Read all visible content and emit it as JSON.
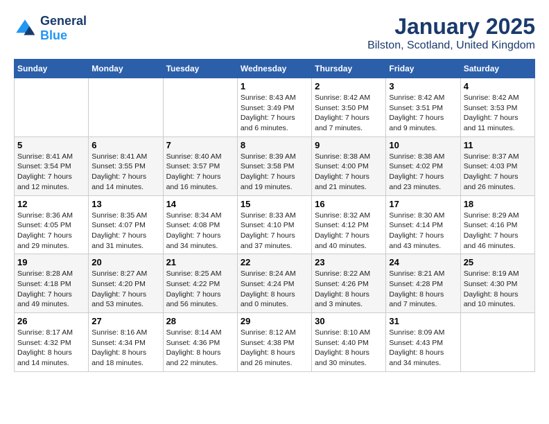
{
  "logo": {
    "general": "General",
    "blue": "Blue"
  },
  "title": "January 2025",
  "location": "Bilston, Scotland, United Kingdom",
  "days_of_week": [
    "Sunday",
    "Monday",
    "Tuesday",
    "Wednesday",
    "Thursday",
    "Friday",
    "Saturday"
  ],
  "weeks": [
    [
      {
        "day": "",
        "sunrise": "",
        "sunset": "",
        "daylight": ""
      },
      {
        "day": "",
        "sunrise": "",
        "sunset": "",
        "daylight": ""
      },
      {
        "day": "",
        "sunrise": "",
        "sunset": "",
        "daylight": ""
      },
      {
        "day": "1",
        "sunrise": "Sunrise: 8:43 AM",
        "sunset": "Sunset: 3:49 PM",
        "daylight": "Daylight: 7 hours and 6 minutes."
      },
      {
        "day": "2",
        "sunrise": "Sunrise: 8:42 AM",
        "sunset": "Sunset: 3:50 PM",
        "daylight": "Daylight: 7 hours and 7 minutes."
      },
      {
        "day": "3",
        "sunrise": "Sunrise: 8:42 AM",
        "sunset": "Sunset: 3:51 PM",
        "daylight": "Daylight: 7 hours and 9 minutes."
      },
      {
        "day": "4",
        "sunrise": "Sunrise: 8:42 AM",
        "sunset": "Sunset: 3:53 PM",
        "daylight": "Daylight: 7 hours and 11 minutes."
      }
    ],
    [
      {
        "day": "5",
        "sunrise": "Sunrise: 8:41 AM",
        "sunset": "Sunset: 3:54 PM",
        "daylight": "Daylight: 7 hours and 12 minutes."
      },
      {
        "day": "6",
        "sunrise": "Sunrise: 8:41 AM",
        "sunset": "Sunset: 3:55 PM",
        "daylight": "Daylight: 7 hours and 14 minutes."
      },
      {
        "day": "7",
        "sunrise": "Sunrise: 8:40 AM",
        "sunset": "Sunset: 3:57 PM",
        "daylight": "Daylight: 7 hours and 16 minutes."
      },
      {
        "day": "8",
        "sunrise": "Sunrise: 8:39 AM",
        "sunset": "Sunset: 3:58 PM",
        "daylight": "Daylight: 7 hours and 19 minutes."
      },
      {
        "day": "9",
        "sunrise": "Sunrise: 8:38 AM",
        "sunset": "Sunset: 4:00 PM",
        "daylight": "Daylight: 7 hours and 21 minutes."
      },
      {
        "day": "10",
        "sunrise": "Sunrise: 8:38 AM",
        "sunset": "Sunset: 4:02 PM",
        "daylight": "Daylight: 7 hours and 23 minutes."
      },
      {
        "day": "11",
        "sunrise": "Sunrise: 8:37 AM",
        "sunset": "Sunset: 4:03 PM",
        "daylight": "Daylight: 7 hours and 26 minutes."
      }
    ],
    [
      {
        "day": "12",
        "sunrise": "Sunrise: 8:36 AM",
        "sunset": "Sunset: 4:05 PM",
        "daylight": "Daylight: 7 hours and 29 minutes."
      },
      {
        "day": "13",
        "sunrise": "Sunrise: 8:35 AM",
        "sunset": "Sunset: 4:07 PM",
        "daylight": "Daylight: 7 hours and 31 minutes."
      },
      {
        "day": "14",
        "sunrise": "Sunrise: 8:34 AM",
        "sunset": "Sunset: 4:08 PM",
        "daylight": "Daylight: 7 hours and 34 minutes."
      },
      {
        "day": "15",
        "sunrise": "Sunrise: 8:33 AM",
        "sunset": "Sunset: 4:10 PM",
        "daylight": "Daylight: 7 hours and 37 minutes."
      },
      {
        "day": "16",
        "sunrise": "Sunrise: 8:32 AM",
        "sunset": "Sunset: 4:12 PM",
        "daylight": "Daylight: 7 hours and 40 minutes."
      },
      {
        "day": "17",
        "sunrise": "Sunrise: 8:30 AM",
        "sunset": "Sunset: 4:14 PM",
        "daylight": "Daylight: 7 hours and 43 minutes."
      },
      {
        "day": "18",
        "sunrise": "Sunrise: 8:29 AM",
        "sunset": "Sunset: 4:16 PM",
        "daylight": "Daylight: 7 hours and 46 minutes."
      }
    ],
    [
      {
        "day": "19",
        "sunrise": "Sunrise: 8:28 AM",
        "sunset": "Sunset: 4:18 PM",
        "daylight": "Daylight: 7 hours and 49 minutes."
      },
      {
        "day": "20",
        "sunrise": "Sunrise: 8:27 AM",
        "sunset": "Sunset: 4:20 PM",
        "daylight": "Daylight: 7 hours and 53 minutes."
      },
      {
        "day": "21",
        "sunrise": "Sunrise: 8:25 AM",
        "sunset": "Sunset: 4:22 PM",
        "daylight": "Daylight: 7 hours and 56 minutes."
      },
      {
        "day": "22",
        "sunrise": "Sunrise: 8:24 AM",
        "sunset": "Sunset: 4:24 PM",
        "daylight": "Daylight: 8 hours and 0 minutes."
      },
      {
        "day": "23",
        "sunrise": "Sunrise: 8:22 AM",
        "sunset": "Sunset: 4:26 PM",
        "daylight": "Daylight: 8 hours and 3 minutes."
      },
      {
        "day": "24",
        "sunrise": "Sunrise: 8:21 AM",
        "sunset": "Sunset: 4:28 PM",
        "daylight": "Daylight: 8 hours and 7 minutes."
      },
      {
        "day": "25",
        "sunrise": "Sunrise: 8:19 AM",
        "sunset": "Sunset: 4:30 PM",
        "daylight": "Daylight: 8 hours and 10 minutes."
      }
    ],
    [
      {
        "day": "26",
        "sunrise": "Sunrise: 8:17 AM",
        "sunset": "Sunset: 4:32 PM",
        "daylight": "Daylight: 8 hours and 14 minutes."
      },
      {
        "day": "27",
        "sunrise": "Sunrise: 8:16 AM",
        "sunset": "Sunset: 4:34 PM",
        "daylight": "Daylight: 8 hours and 18 minutes."
      },
      {
        "day": "28",
        "sunrise": "Sunrise: 8:14 AM",
        "sunset": "Sunset: 4:36 PM",
        "daylight": "Daylight: 8 hours and 22 minutes."
      },
      {
        "day": "29",
        "sunrise": "Sunrise: 8:12 AM",
        "sunset": "Sunset: 4:38 PM",
        "daylight": "Daylight: 8 hours and 26 minutes."
      },
      {
        "day": "30",
        "sunrise": "Sunrise: 8:10 AM",
        "sunset": "Sunset: 4:40 PM",
        "daylight": "Daylight: 8 hours and 30 minutes."
      },
      {
        "day": "31",
        "sunrise": "Sunrise: 8:09 AM",
        "sunset": "Sunset: 4:43 PM",
        "daylight": "Daylight: 8 hours and 34 minutes."
      },
      {
        "day": "",
        "sunrise": "",
        "sunset": "",
        "daylight": ""
      }
    ]
  ]
}
